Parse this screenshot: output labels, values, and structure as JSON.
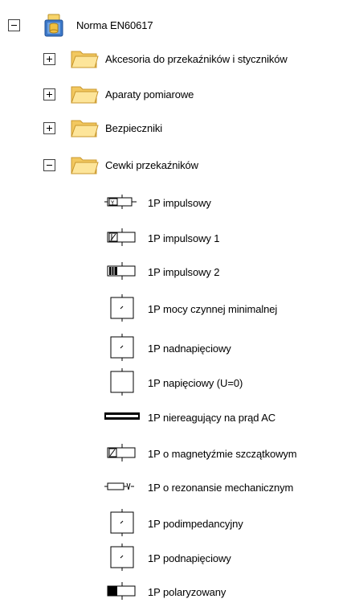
{
  "tree": {
    "root": {
      "label": "Norma EN60617",
      "icon": "database-folder-icon",
      "expanded": true
    },
    "folders": [
      {
        "label": "Akcesoria do przekaźników i styczników",
        "expanded": false
      },
      {
        "label": "Aparaty pomiarowe",
        "expanded": false
      },
      {
        "label": "Bezpieczniki",
        "expanded": false
      },
      {
        "label": "Cewki przekaźników",
        "expanded": true
      }
    ],
    "items": [
      {
        "label": "1P impulsowy",
        "symbol": "relay-coil-impulse-y-icon"
      },
      {
        "label": "1P impulsowy 1",
        "symbol": "relay-coil-impulse-1-icon"
      },
      {
        "label": "1P impulsowy 2",
        "symbol": "relay-coil-impulse-2-icon"
      },
      {
        "label": "1P mocy czynnej minimalnej",
        "symbol": "relay-coil-min-active-power-icon"
      },
      {
        "label": "1P nadnapięciowy",
        "symbol": "relay-coil-overvoltage-icon"
      },
      {
        "label": "1P napięciowy (U=0)",
        "symbol": "relay-coil-voltage-icon"
      },
      {
        "label": "1P niereagujący na prąd AC",
        "symbol": "relay-coil-ac-insensitive-icon"
      },
      {
        "label": "1P o magnetyźmie szczątkowym",
        "symbol": "relay-coil-remanence-icon"
      },
      {
        "label": "1P o rezonansie mechanicznym",
        "symbol": "relay-coil-resonance-icon"
      },
      {
        "label": "1P podimpedancyjny",
        "symbol": "relay-coil-underimpedance-icon"
      },
      {
        "label": "1P podnapięciowy",
        "symbol": "relay-coil-undervoltage-icon"
      },
      {
        "label": "1P polaryzowany",
        "symbol": "relay-coil-polarized-icon"
      }
    ]
  },
  "colors": {
    "folder_light": "#fde59a",
    "folder_dark": "#e8b94a",
    "folder_edge": "#c9972c",
    "db_blue": "#3c78c8",
    "db_gold": "#f0c040"
  }
}
